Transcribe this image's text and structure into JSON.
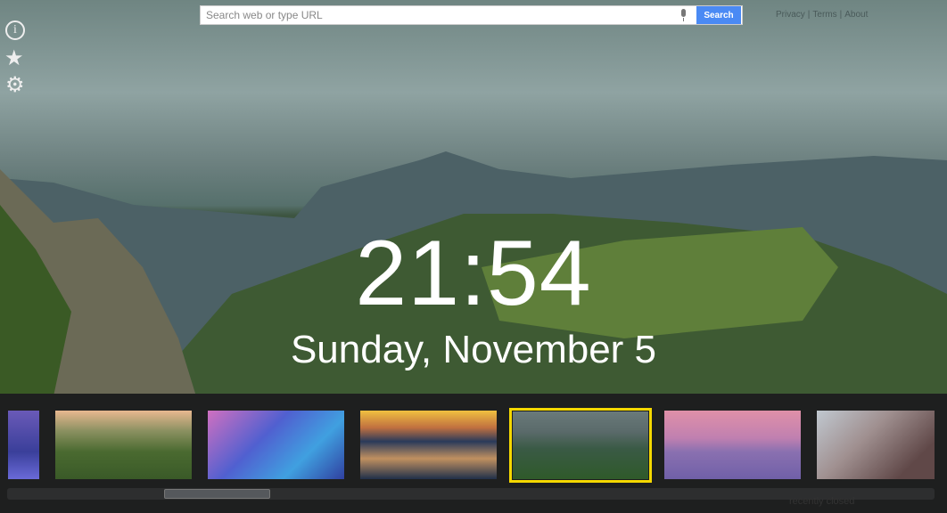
{
  "search": {
    "placeholder": "Search web or type URL",
    "button": "Search"
  },
  "links": [
    "Privacy",
    "|",
    "Terms",
    "|",
    "About"
  ],
  "sidebar": {
    "icons": [
      "info-icon",
      "star-icon",
      "gear-icon"
    ]
  },
  "clock": {
    "time": "21:54",
    "date": "Sunday, November 5"
  },
  "gallery": {
    "selected_index": 4,
    "thumbnails": [
      "city-bridge",
      "river-valley",
      "fantasy-abstract",
      "sunset-peaks",
      "green-mountains",
      "pink-volcano",
      "clouds"
    ]
  },
  "recently_closed": "recently closed"
}
